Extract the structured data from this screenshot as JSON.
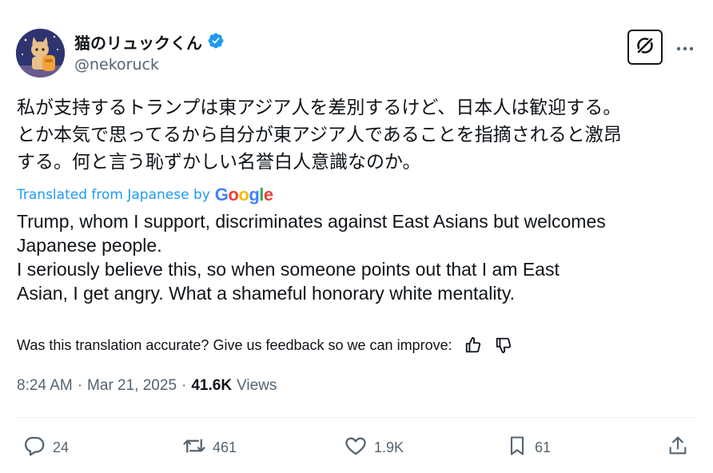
{
  "author": {
    "display_name": "猫のリュックくん",
    "handle": "@nekoruck",
    "verified": true,
    "verified_color": "#1d9bf0"
  },
  "post": {
    "original_text": "私が支持するトランプは東アジア人を差別するけど、日本人は歓迎する。\nとか本気で思ってるから自分が東アジア人であることを指摘されると激昂\nする。何と言う恥ずかしい名誉白人意識なのか。",
    "translated_from": "Translated from Japanese by",
    "translator": "Google",
    "translated_text": "Trump, whom I support, discriminates against East Asians but welcomes\nJapanese people.\nI seriously believe this, so when someone points out that I am East\nAsian, I get angry. What a shameful honorary white mentality.",
    "feedback_prompt": "Was this translation accurate? Give us feedback so we can improve:",
    "time": "8:24 AM",
    "separator": "·",
    "date": "Mar 21, 2025",
    "views_count": "41.6K",
    "views_label": "Views"
  },
  "actions": {
    "replies": "24",
    "reposts": "461",
    "likes": "1.9K",
    "bookmarks": "61"
  },
  "icons": {
    "verified": "verified-badge-icon",
    "grok": "grok-icon",
    "more": "more-dots-icon",
    "thumbs_up": "thumbs-up-icon",
    "thumbs_down": "thumbs-down-icon",
    "reply": "reply-icon",
    "repost": "repost-icon",
    "like": "heart-icon",
    "bookmark": "bookmark-icon",
    "share": "share-icon"
  },
  "colors": {
    "text": "#0f1419",
    "secondary": "#536471",
    "accent": "#1d9bf0",
    "divider": "#eff3f4"
  }
}
